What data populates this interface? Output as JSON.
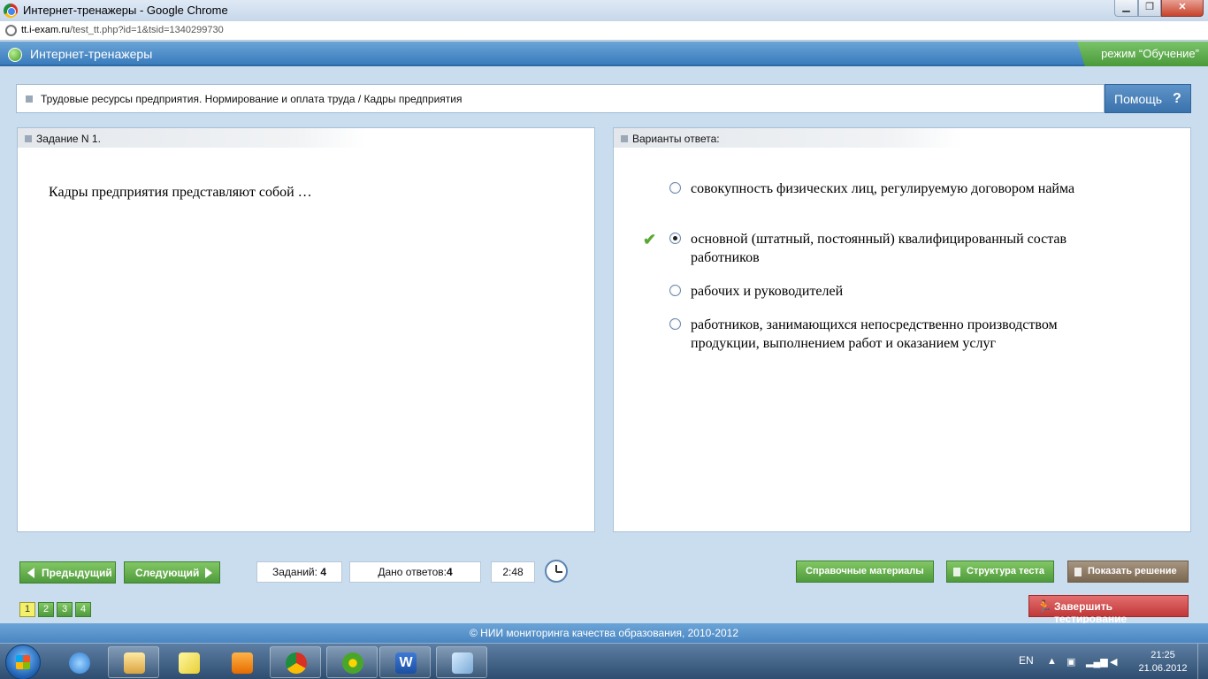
{
  "window": {
    "title": "Интернет-тренажеры - Google Chrome",
    "url_host": "tt.i-exam.ru",
    "url_path": "/test_tt.php?id=1&tsid=1340299730"
  },
  "app": {
    "title": "Интернет-тренажеры",
    "mode": "режим “Обучение”"
  },
  "breadcrumb": "Трудовые ресурсы предприятия. Нормирование и оплата труда / Кадры предприятия",
  "help_label": "Помощь",
  "task": {
    "header": "Задание N 1.",
    "question": "Кадры предприятия представляют собой …"
  },
  "answers": {
    "header": "Варианты ответа:",
    "options": [
      {
        "text": "совокупность физических лиц, регулируемую договором найма",
        "selected": false,
        "correct": false
      },
      {
        "text": "основной (штатный, постоянный) квалифицированный состав работников",
        "selected": true,
        "correct": true
      },
      {
        "text": "рабочих и руководителей",
        "selected": false,
        "correct": false
      },
      {
        "text": "работников, занимающихся непосредственно производством продукции, выполнением работ и оказанием услуг",
        "selected": false,
        "correct": false
      }
    ]
  },
  "nav": {
    "prev_label": "Предыдущий",
    "next_label": "Следующий"
  },
  "stats": {
    "tasks_label": "Заданий:",
    "tasks_count": "4",
    "answers_label": "Дано ответов:",
    "answers_count": "4",
    "timer": "2:48"
  },
  "actions": {
    "reference_label": "Справочные материалы",
    "structure_label": "Структура теста",
    "solution_label": "Показать решение",
    "finish_label": "Завершить тестирование"
  },
  "pages": [
    "1",
    "2",
    "3",
    "4"
  ],
  "current_page": "1",
  "footer": "© НИИ мониторинга качества образования, 2010-2012",
  "taskbar": {
    "lang": "EN",
    "time": "21:25",
    "date": "21.06.2012"
  },
  "colors": {
    "header_blue": "#3a7cbd",
    "button_green": "#4e9a3c",
    "finish_red": "#c13838",
    "solution_brown": "#7a6752",
    "current_page_yellow": "#f3f06a"
  }
}
